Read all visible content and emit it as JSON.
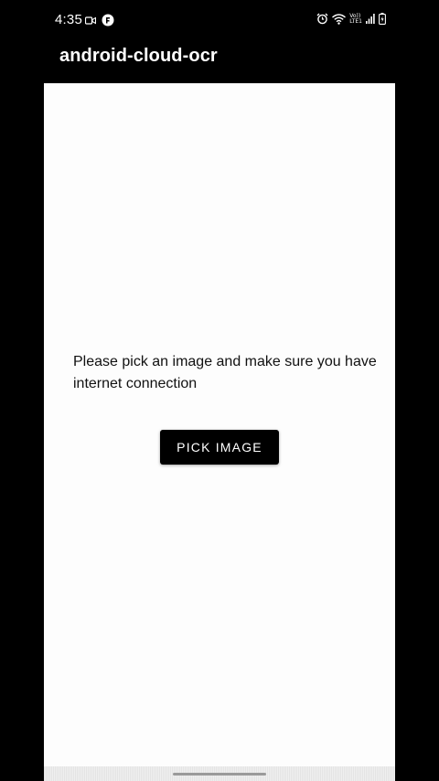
{
  "status_bar": {
    "time": "4:35",
    "left_icons": [
      "video-icon",
      "app-notification-icon"
    ],
    "right_icons": [
      "alarm-icon",
      "wifi-icon",
      "volte-lte-icon",
      "signal-icon",
      "battery-icon"
    ],
    "network_label_top": "Vo))",
    "network_label_bottom": "LTE1"
  },
  "app_bar": {
    "title": "android-cloud-ocr"
  },
  "main": {
    "message": "Please pick an image and make sure you have internet connection",
    "pick_button_label": "PICK IMAGE"
  },
  "colors": {
    "background": "#000000",
    "content_background": "#fdfdfd",
    "button_background": "#000000",
    "button_text": "#ffffff",
    "text": "#111111"
  }
}
